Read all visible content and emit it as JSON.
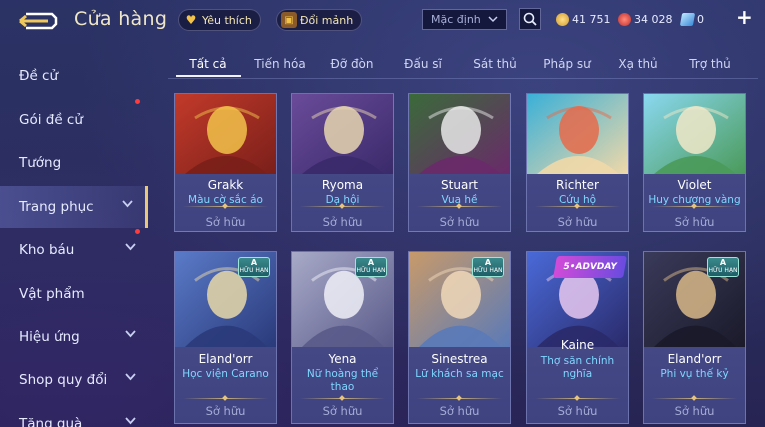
{
  "header": {
    "title": "Cửa hàng",
    "favorites_label": "Yêu thích",
    "fragments_label": "Đổi mảnh",
    "sort_value": "Mặc định",
    "currencies": [
      {
        "value": "41 751",
        "color": "#f0c24a"
      },
      {
        "value": "34 028",
        "color": "#e04a4a"
      },
      {
        "value": "0",
        "color": "#7fd0ff"
      }
    ]
  },
  "sidebar": {
    "items": [
      {
        "label": "Đề cử",
        "chevron": false,
        "dot": false
      },
      {
        "label": "Gói đề cử",
        "chevron": false,
        "dot": true
      },
      {
        "label": "Tướng",
        "chevron": false,
        "dot": false
      },
      {
        "label": "Trang phục",
        "chevron": true,
        "dot": false,
        "active": true
      },
      {
        "label": "Kho báu",
        "chevron": true,
        "dot": true
      },
      {
        "label": "Vật phẩm",
        "chevron": false,
        "dot": false
      },
      {
        "label": "Hiệu ứng",
        "chevron": true,
        "dot": false
      },
      {
        "label": "Shop quy đổi",
        "chevron": true,
        "dot": false
      },
      {
        "label": "Tặng quà",
        "chevron": true,
        "dot": false
      }
    ]
  },
  "tabs": [
    "Tất cả",
    "Tiến hóa",
    "Đỡ đòn",
    "Đấu sĩ",
    "Sát thủ",
    "Pháp sư",
    "Xạ thủ",
    "Trợ thủ"
  ],
  "active_tab": "Tất cả",
  "owned_label": "Sở hữu",
  "badge_rank": "A",
  "badge_limited": "HỮU HẠN",
  "badge_event": "5•ADVDAY",
  "cards": [
    {
      "name": "Grakk",
      "skin": "Màu cờ sắc áo",
      "colors": [
        "#c23a2a",
        "#f2c24a",
        "#7a1f1a"
      ]
    },
    {
      "name": "Ryoma",
      "skin": "Dạ hội",
      "colors": [
        "#6a4b9a",
        "#e8d6b0",
        "#3a2a6a"
      ]
    },
    {
      "name": "Stuart",
      "skin": "Vua hề",
      "colors": [
        "#3a6a3a",
        "#e8e8e8",
        "#6a2a6a"
      ]
    },
    {
      "name": "Richter",
      "skin": "Cứu hộ",
      "colors": [
        "#3ab0d8",
        "#e86a4a",
        "#f0d8a8"
      ]
    },
    {
      "name": "Violet",
      "skin": "Huy chương vàng",
      "colors": [
        "#8ad8f0",
        "#f0e8c8",
        "#4a9a5a"
      ]
    },
    {
      "name": "Eland'orr",
      "skin": "Học viện Carano",
      "colors": [
        "#5a7ac8",
        "#e8d8a8",
        "#2a3a7a"
      ],
      "badge": "limited"
    },
    {
      "name": "Yena",
      "skin": "Nữ hoàng thể thao",
      "colors": [
        "#a8aac8",
        "#f0f0f8",
        "#5a5a8a"
      ],
      "badge": "limited"
    },
    {
      "name": "Sinestrea",
      "skin": "Lữ khách sa mạc",
      "colors": [
        "#c89a6a",
        "#f0d8b8",
        "#5a7ab8"
      ],
      "badge": "limited"
    },
    {
      "name": "Kaine",
      "skin": "Thợ săn chính nghĩa",
      "colors": [
        "#4a6ad8",
        "#e8c8f0",
        "#2a2a6a"
      ],
      "badge": "event"
    },
    {
      "name": "Eland'orr",
      "skin": "Phi vụ thế kỷ",
      "colors": [
        "#3a3a5a",
        "#d8b888",
        "#1a1a2a"
      ],
      "badge": "limited"
    }
  ]
}
